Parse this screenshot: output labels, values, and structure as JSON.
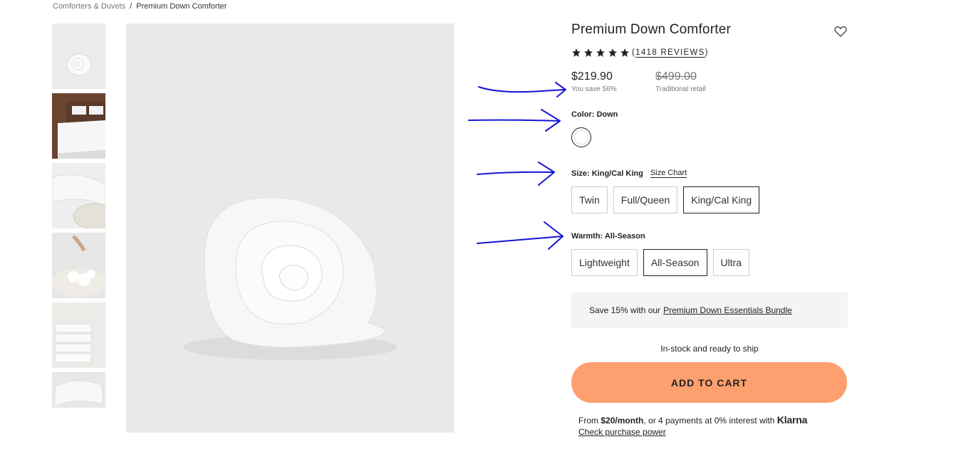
{
  "breadcrumb": {
    "parent": "Comforters & Duvets",
    "separator": "/",
    "current": "Premium Down Comforter"
  },
  "product": {
    "title": "Premium Down Comforter",
    "rating": 5,
    "reviews_label": "1418 REVIEWS",
    "price": "$219.90",
    "savings": "You save 56%",
    "retail_price": "$499.00",
    "retail_note": "Traditional retail"
  },
  "color": {
    "label": "Color: Down",
    "swatches": [
      "white"
    ]
  },
  "size": {
    "label": "Size: King/Cal King",
    "chart_link": "Size Chart",
    "options": [
      "Twin",
      "Full/Queen",
      "King/Cal King"
    ],
    "selected": "King/Cal King"
  },
  "warmth": {
    "label": "Warmth: All-Season",
    "options": [
      "Lightweight",
      "All-Season",
      "Ultra"
    ],
    "selected": "All-Season"
  },
  "bundle": {
    "text": "Save 15% with our",
    "link": "Premium Down Essentials Bundle"
  },
  "stock": "In-stock and ready to ship",
  "cart_button": "ADD TO CART",
  "klarna": {
    "from": "From",
    "amount": "$20/month",
    "rest": ", or 4 payments at 0% interest with",
    "brand": "Klarna",
    "link": "Check purchase power"
  },
  "colors": {
    "accent": "#fd9f6e",
    "annotation": "#1414d8",
    "image_bg": "#e9e9e9"
  },
  "icons": {
    "wishlist": "heart-icon",
    "star": "star-icon"
  }
}
